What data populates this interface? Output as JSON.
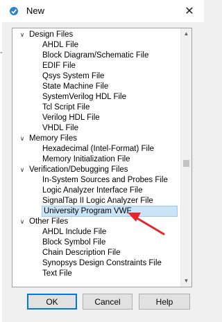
{
  "window": {
    "title": "New"
  },
  "background_fragment": "-b",
  "tree": [
    {
      "label": "Design Files",
      "items": [
        "AHDL File",
        "Block Diagram/Schematic File",
        "EDIF File",
        "Qsys System File",
        "State Machine File",
        "SystemVerilog HDL File",
        "Tcl Script File",
        "Verilog HDL File",
        "VHDL File"
      ]
    },
    {
      "label": "Memory Files",
      "items": [
        "Hexadecimal (Intel-Format) File",
        "Memory Initialization File"
      ]
    },
    {
      "label": "Verification/Debugging Files",
      "items": [
        "In-System Sources and Probes File",
        "Logic Analyzer Interface File",
        "SignalTap II Logic Analyzer File",
        "University Program VWF"
      ]
    },
    {
      "label": "Other Files",
      "items": [
        "AHDL Include File",
        "Block Symbol File",
        "Chain Description File",
        "Synopsys Design Constraints File",
        "Text File"
      ]
    }
  ],
  "selected_item": "University Program VWF",
  "buttons": {
    "ok": "OK",
    "cancel": "Cancel",
    "help": "Help"
  },
  "icons": {
    "caret": "∨",
    "close": "✕",
    "scroll_up": "▲",
    "scroll_down": "▼"
  },
  "colors": {
    "accent": "#0078d7",
    "selection": "#cce4f7",
    "annotation_arrow": "#e8232a"
  }
}
